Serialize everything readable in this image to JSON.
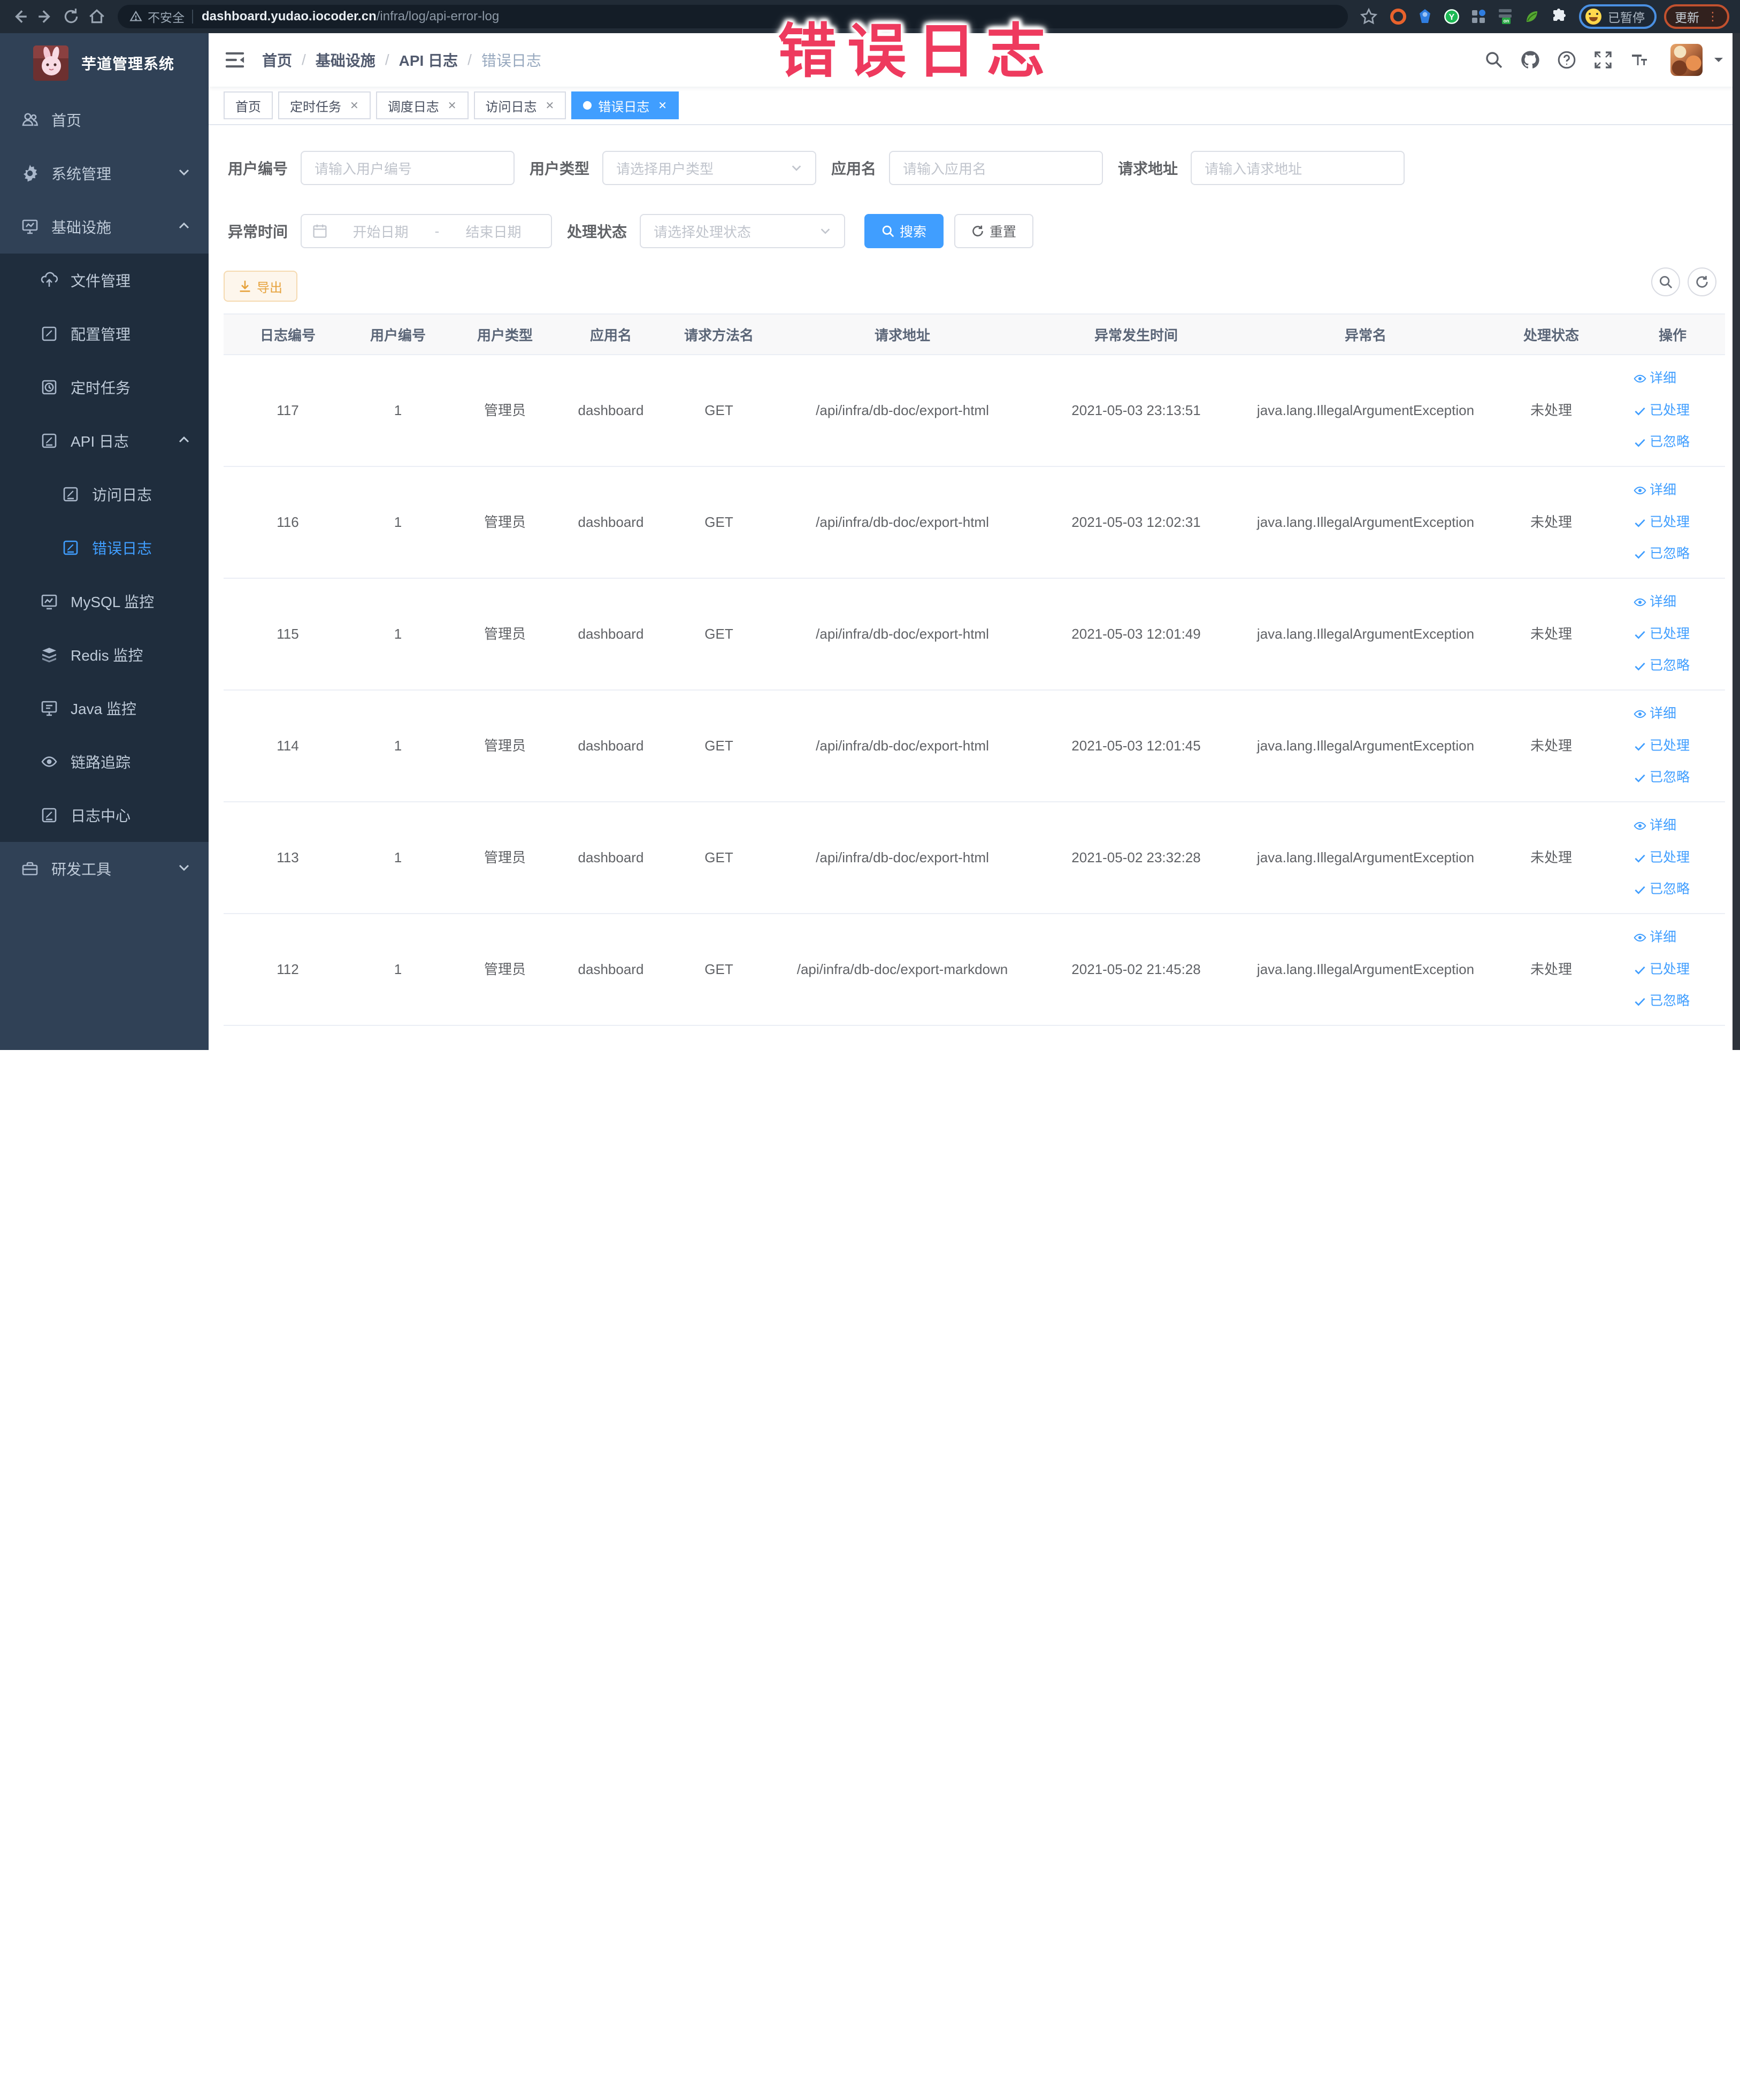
{
  "browser": {
    "security_label": "不安全",
    "url_host": "dashboard.yudao.iocoder.cn",
    "url_path": "/infra/log/api-error-log",
    "profile_chip_label": "已暂停",
    "update_button_label": "更新"
  },
  "annotation": {
    "text": "错误日志",
    "color": "#ee3a5e"
  },
  "sidebar": {
    "logo_title": "芋道管理系统",
    "items": [
      {
        "key": "home",
        "label": "首页",
        "icon": "home-icon",
        "level": 1
      },
      {
        "key": "system",
        "label": "系统管理",
        "icon": "gear-icon",
        "level": 1,
        "arrow": "down"
      },
      {
        "key": "infra",
        "label": "基础设施",
        "icon": "infra-icon",
        "level": 1,
        "arrow": "up"
      },
      {
        "key": "file",
        "label": "文件管理",
        "icon": "file-icon",
        "level": 2,
        "sub": true
      },
      {
        "key": "config",
        "label": "配置管理",
        "icon": "config-icon",
        "level": 2,
        "sub": true
      },
      {
        "key": "job",
        "label": "定时任务",
        "icon": "job-icon",
        "level": 2,
        "sub": true
      },
      {
        "key": "api-log",
        "label": "API 日志",
        "icon": "apilog-icon",
        "level": 2,
        "arrow": "up",
        "sub": true
      },
      {
        "key": "access-log",
        "label": "访问日志",
        "icon": "doc-icon",
        "level": 3,
        "sub": true
      },
      {
        "key": "error-log",
        "label": "错误日志",
        "icon": "doc-icon",
        "level": 3,
        "sub": true,
        "active": true
      },
      {
        "key": "mysql",
        "label": "MySQL 监控",
        "icon": "mysql-icon",
        "level": 2,
        "sub": true
      },
      {
        "key": "redis",
        "label": "Redis 监控",
        "icon": "redis-icon",
        "level": 2,
        "sub": true
      },
      {
        "key": "java",
        "label": "Java 监控",
        "icon": "java-icon",
        "level": 2,
        "sub": true
      },
      {
        "key": "trace",
        "label": "链路追踪",
        "icon": "trace-icon",
        "level": 2,
        "sub": true
      },
      {
        "key": "log-center",
        "label": "日志中心",
        "icon": "logcenter-icon",
        "level": 2,
        "sub": true
      },
      {
        "key": "dev-tool",
        "label": "研发工具",
        "icon": "tool-icon",
        "level": 1,
        "arrow": "down"
      }
    ]
  },
  "navbar": {
    "breadcrumb": [
      "首页",
      "基础设施",
      "API 日志",
      "错误日志"
    ]
  },
  "tags": [
    {
      "label": "首页",
      "closable": false,
      "active": false
    },
    {
      "label": "定时任务",
      "closable": true,
      "active": false
    },
    {
      "label": "调度日志",
      "closable": true,
      "active": false
    },
    {
      "label": "访问日志",
      "closable": true,
      "active": false
    },
    {
      "label": "错误日志",
      "closable": true,
      "active": true
    }
  ],
  "filters": {
    "fields": [
      {
        "label": "用户编号",
        "placeholder": "请输入用户编号",
        "type": "input"
      },
      {
        "label": "用户类型",
        "placeholder": "请选择用户类型",
        "type": "select"
      },
      {
        "label": "应用名",
        "placeholder": "请输入应用名",
        "type": "input"
      },
      {
        "label": "请求地址",
        "placeholder": "请输入请求地址",
        "type": "input"
      }
    ],
    "date_range": {
      "label": "异常时间",
      "start_placeholder": "开始日期",
      "separator": "-",
      "end_placeholder": "结束日期"
    },
    "status_select": {
      "label": "处理状态",
      "placeholder": "请选择处理状态"
    },
    "search_label": "搜索",
    "reset_label": "重置",
    "export_label": "导出"
  },
  "table": {
    "columns": [
      "日志编号",
      "用户编号",
      "用户类型",
      "应用名",
      "请求方法名",
      "请求地址",
      "异常发生时间",
      "异常名",
      "处理状态",
      "操作"
    ],
    "rows": [
      {
        "id": "117",
        "user_id": "1",
        "user_type": "管理员",
        "app": "dashboard",
        "method": "GET",
        "url": "/api/infra/db-doc/export-html",
        "time": "2021-05-03 23:13:51",
        "exception": "java.lang.IllegalArgumentException",
        "status": "未处理"
      },
      {
        "id": "116",
        "user_id": "1",
        "user_type": "管理员",
        "app": "dashboard",
        "method": "GET",
        "url": "/api/infra/db-doc/export-html",
        "time": "2021-05-03 12:02:31",
        "exception": "java.lang.IllegalArgumentException",
        "status": "未处理"
      },
      {
        "id": "115",
        "user_id": "1",
        "user_type": "管理员",
        "app": "dashboard",
        "method": "GET",
        "url": "/api/infra/db-doc/export-html",
        "time": "2021-05-03 12:01:49",
        "exception": "java.lang.IllegalArgumentException",
        "status": "未处理"
      },
      {
        "id": "114",
        "user_id": "1",
        "user_type": "管理员",
        "app": "dashboard",
        "method": "GET",
        "url": "/api/infra/db-doc/export-html",
        "time": "2021-05-03 12:01:45",
        "exception": "java.lang.IllegalArgumentException",
        "status": "未处理"
      },
      {
        "id": "113",
        "user_id": "1",
        "user_type": "管理员",
        "app": "dashboard",
        "method": "GET",
        "url": "/api/infra/db-doc/export-html",
        "time": "2021-05-02 23:32:28",
        "exception": "java.lang.IllegalArgumentException",
        "status": "未处理"
      },
      {
        "id": "112",
        "user_id": "1",
        "user_type": "管理员",
        "app": "dashboard",
        "method": "GET",
        "url": "/api/infra/db-doc/export-markdown",
        "time": "2021-05-02 21:45:28",
        "exception": "java.lang.IllegalArgumentException",
        "status": "未处理"
      }
    ],
    "actions": [
      {
        "label": "详细",
        "icon": "eye-icon"
      },
      {
        "label": "已处理",
        "icon": "check-icon"
      },
      {
        "label": "已忽略",
        "icon": "check-icon"
      }
    ]
  }
}
